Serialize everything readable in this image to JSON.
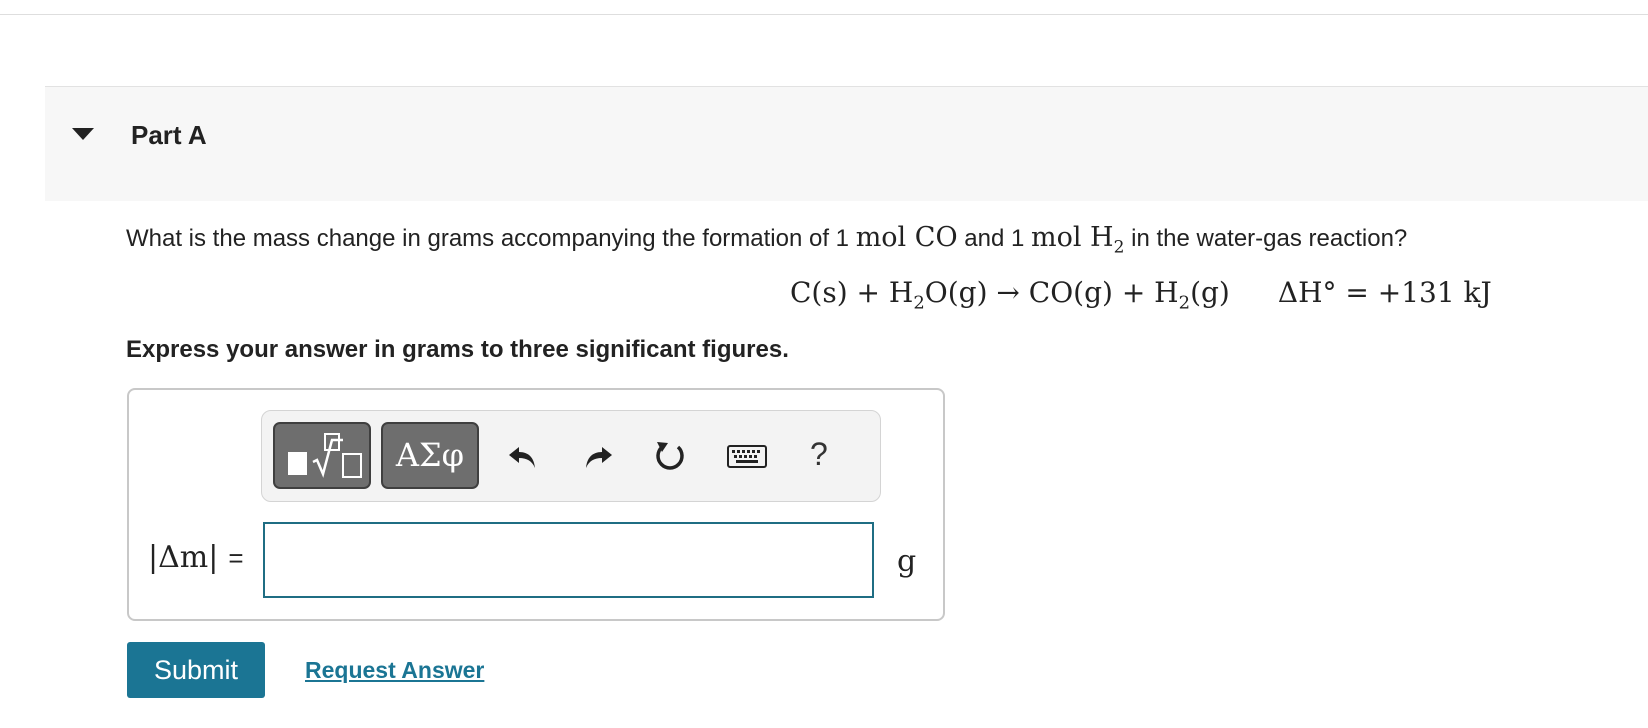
{
  "part": {
    "title": "Part A"
  },
  "question": {
    "pre": "What is the mass change in grams accompanying the formation of 1 ",
    "mol1": "mol CO",
    "mid": " and 1 ",
    "mol2": "mol H",
    "mol2_sub": "2",
    "post": " in the water-gas reaction?"
  },
  "equation": {
    "p1": "C(s) + H",
    "s1": "2",
    "p2": "O(g) → CO(g) + H",
    "s2": "2",
    "p3": "(g)",
    "enthalpy": "ΔH° = +131 kJ"
  },
  "instruction": "Express your answer in grams to three significant figures.",
  "toolbar": {
    "greek_label": "ΑΣφ",
    "help_label": "?",
    "icons": [
      "templates-icon",
      "greek-symbols-icon",
      "undo-icon",
      "redo-icon",
      "reset-icon",
      "keyboard-icon",
      "help-icon"
    ]
  },
  "answer": {
    "label": "|Δm|",
    "equals": "=",
    "value": "",
    "unit": "g"
  },
  "actions": {
    "submit_label": "Submit",
    "request_label": "Request Answer"
  },
  "colors": {
    "accent": "#1b7594",
    "input_border": "#1f6d83",
    "toolbar_button": "#6e6e6e"
  }
}
